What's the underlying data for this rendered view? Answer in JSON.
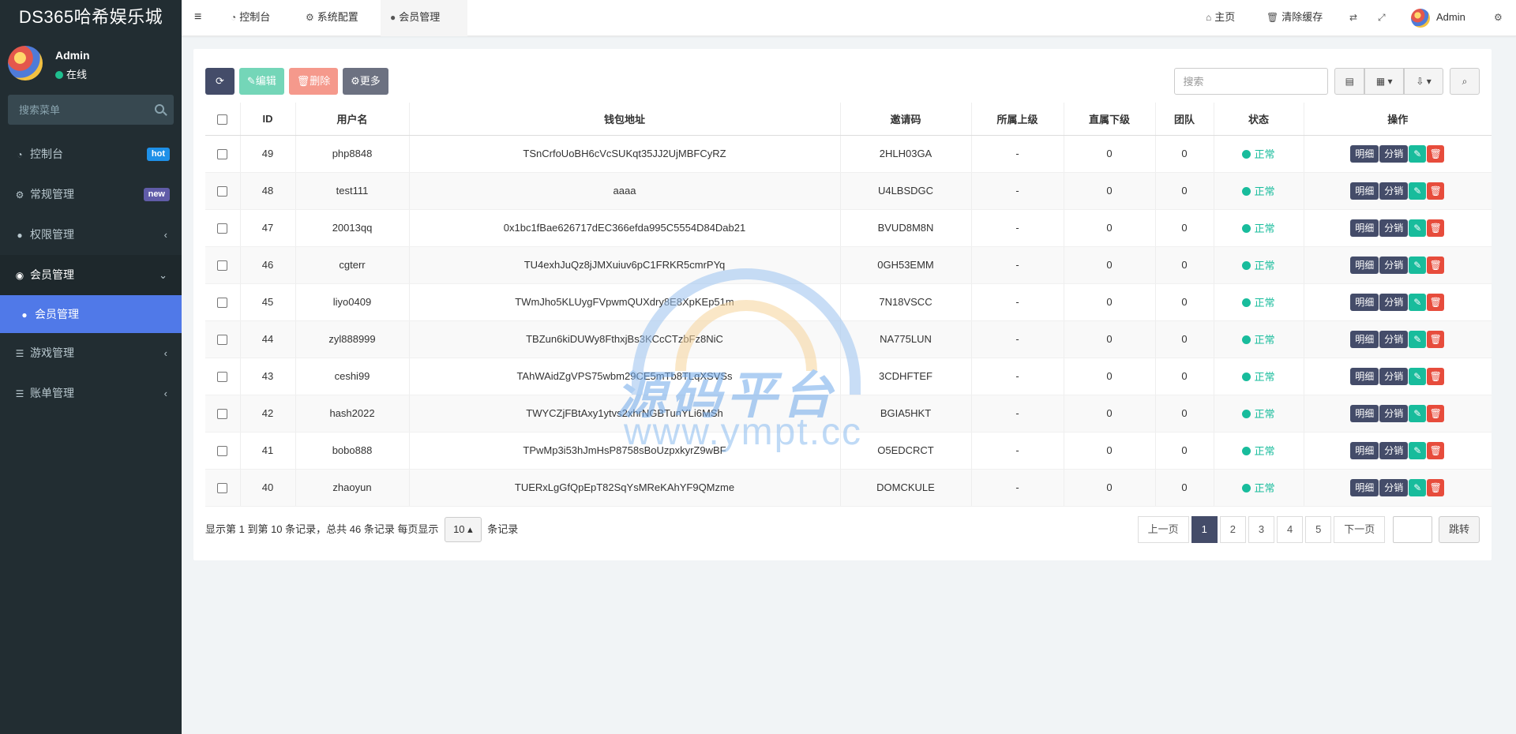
{
  "app": {
    "title": "DS365哈希娱乐城"
  },
  "user": {
    "name": "Admin",
    "status": "在线"
  },
  "sidebar": {
    "search_placeholder": "搜索菜单",
    "items": [
      {
        "label": "控制台",
        "icon": "dashboard-icon",
        "badge": "hot"
      },
      {
        "label": "常规管理",
        "icon": "cogs-icon",
        "badge": "new"
      },
      {
        "label": "权限管理",
        "icon": "group-icon",
        "chevron": "‹"
      },
      {
        "label": "会员管理",
        "icon": "user-circle-icon",
        "chevron": "⌄",
        "open": true
      },
      {
        "label": "游戏管理",
        "icon": "list-icon",
        "chevron": "‹"
      },
      {
        "label": "账单管理",
        "icon": "list-icon",
        "chevron": "‹"
      }
    ],
    "submenu_active": "会员管理"
  },
  "header": {
    "tabs": [
      {
        "label": "控制台",
        "icon": "dashboard-icon"
      },
      {
        "label": "系统配置",
        "icon": "gear-icon"
      },
      {
        "label": "会员管理",
        "icon": "user-icon"
      }
    ],
    "home": "主页",
    "clear_cache": "清除缓存",
    "admin": "Admin"
  },
  "toolbar": {
    "edit": "编辑",
    "delete": "删除",
    "more": "更多",
    "search_placeholder": "搜索"
  },
  "table": {
    "columns": [
      "ID",
      "用户名",
      "钱包地址",
      "邀请码",
      "所属上级",
      "直属下级",
      "团队",
      "状态",
      "操作"
    ],
    "actions": {
      "detail": "明细",
      "distribution": "分销"
    },
    "rows": [
      {
        "id": "49",
        "username": "php8848",
        "wallet": "TSnCrfoUoBH6cVcSUKqt35JJ2UjMBFCyRZ",
        "code": "2HLH03GA",
        "parent": "-",
        "direct": "0",
        "team": "0",
        "status": "正常"
      },
      {
        "id": "48",
        "username": "test111",
        "wallet": "aaaa",
        "code": "U4LBSDGC",
        "parent": "-",
        "direct": "0",
        "team": "0",
        "status": "正常"
      },
      {
        "id": "47",
        "username": "20013qq",
        "wallet": "0x1bc1fBae626717dEC366efda995C5554D84Dab21",
        "code": "BVUD8M8N",
        "parent": "-",
        "direct": "0",
        "team": "0",
        "status": "正常"
      },
      {
        "id": "46",
        "username": "cgterr",
        "wallet": "TU4exhJuQz8jJMXuiuv6pC1FRKR5cmrPYq",
        "code": "0GH53EMM",
        "parent": "-",
        "direct": "0",
        "team": "0",
        "status": "正常"
      },
      {
        "id": "45",
        "username": "liyo0409",
        "wallet": "TWmJho5KLUygFVpwmQUXdry8E8XpKEp51m",
        "code": "7N18VSCC",
        "parent": "-",
        "direct": "0",
        "team": "0",
        "status": "正常"
      },
      {
        "id": "44",
        "username": "zyl888999",
        "wallet": "TBZun6kiDUWy8FthxjBs3KCcCTzbFz8NiC",
        "code": "NA775LUN",
        "parent": "-",
        "direct": "0",
        "team": "0",
        "status": "正常"
      },
      {
        "id": "43",
        "username": "ceshi99",
        "wallet": "TAhWAidZgVPS75wbm29CE5mTb8TLqXSVSs",
        "code": "3CDHFTEF",
        "parent": "-",
        "direct": "0",
        "team": "0",
        "status": "正常"
      },
      {
        "id": "42",
        "username": "hash2022",
        "wallet": "TWYCZjFBtAxy1ytvs2xhrNGBTunYLi6MSh",
        "code": "BGIA5HKT",
        "parent": "-",
        "direct": "0",
        "team": "0",
        "status": "正常"
      },
      {
        "id": "41",
        "username": "bobo888",
        "wallet": "TPwMp3i53hJmHsP8758sBoUzpxkyrZ9wBF",
        "code": "O5EDCRCT",
        "parent": "-",
        "direct": "0",
        "team": "0",
        "status": "正常"
      },
      {
        "id": "40",
        "username": "zhaoyun",
        "wallet": "TUERxLgGfQpEpT82SqYsMReKAhYF9QMzme",
        "code": "DOMCKULE",
        "parent": "-",
        "direct": "0",
        "team": "0",
        "status": "正常"
      }
    ]
  },
  "footer": {
    "summary": "显示第 1 到第 10 条记录，总共 46 条记录 每页显示",
    "page_size": "10",
    "records_suffix": "条记录",
    "prev": "上一页",
    "next": "下一页",
    "pages": [
      "1",
      "2",
      "3",
      "4",
      "5"
    ],
    "jump": "跳转"
  },
  "watermark": {
    "text": "源码平台",
    "url": "www.ympt.cc"
  },
  "colors": {
    "sidebar_bg": "#222d32",
    "active_menu": "#5079e8",
    "primary": "#444c69",
    "success": "#18bc9c",
    "danger": "#e74c3c"
  }
}
